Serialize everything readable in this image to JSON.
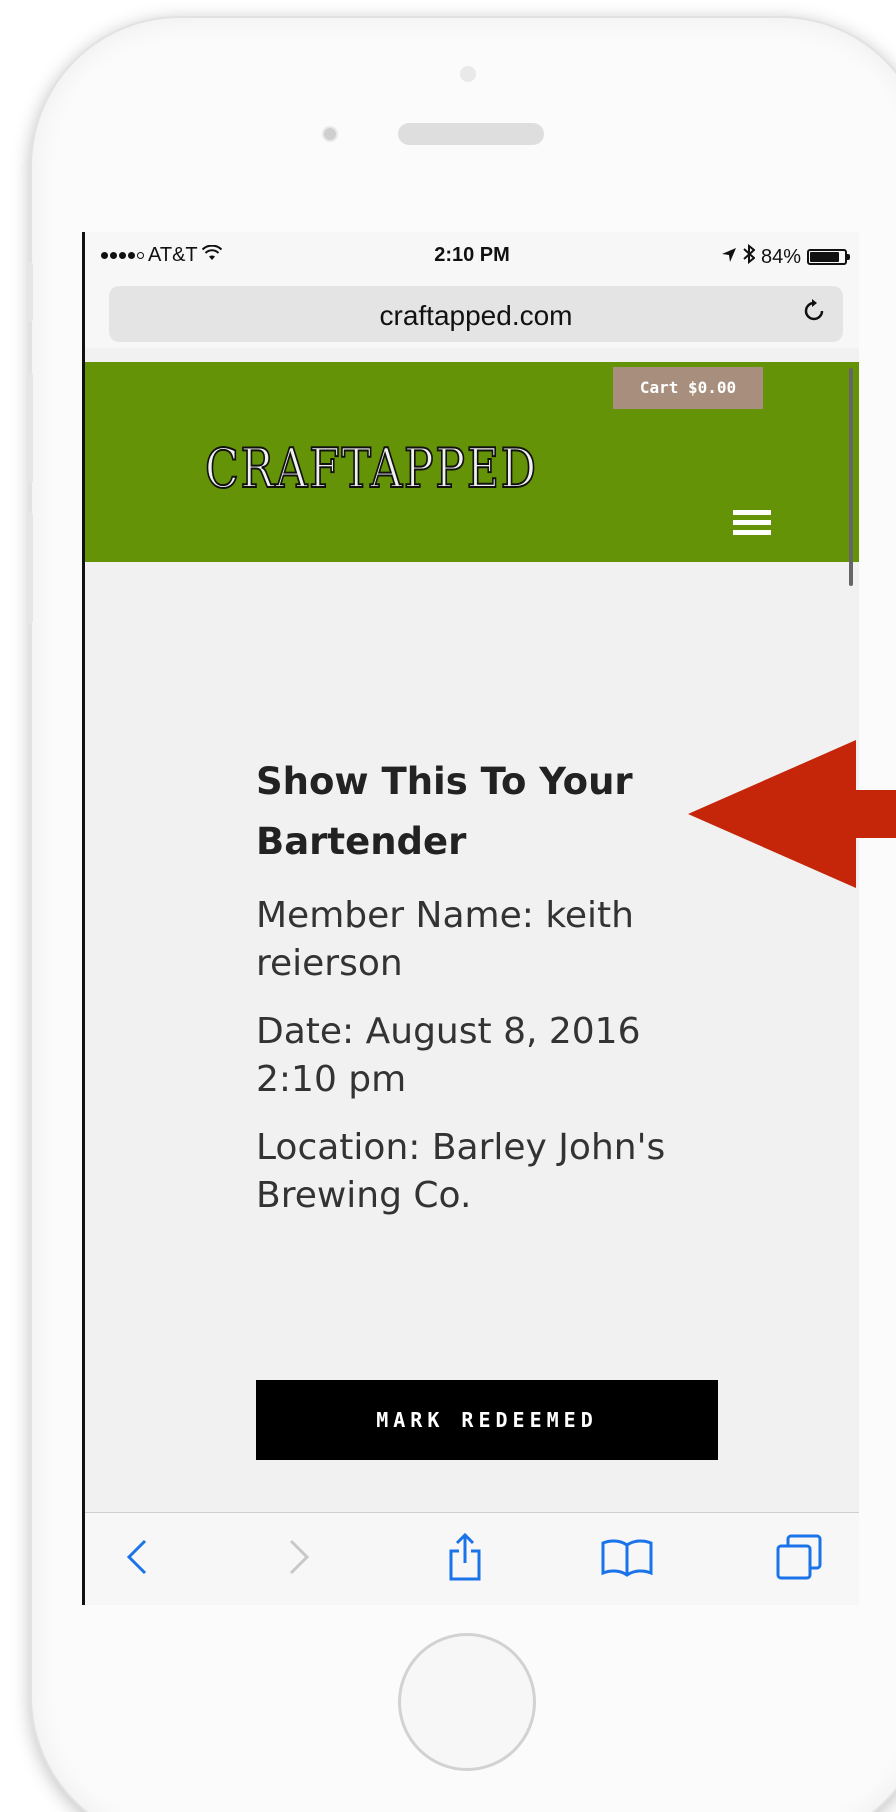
{
  "status_bar": {
    "carrier": "AT&T",
    "time": "2:10 PM",
    "battery": "84%",
    "battery_level": 0.84
  },
  "browser": {
    "url": "craftapped.com"
  },
  "site_header": {
    "cart_label": "Cart $0.00",
    "logo_text": "CRAFTAPPED",
    "header_color": "#649307",
    "cart_color": "#a88e7c"
  },
  "content": {
    "title": "Show This To Your Bartender",
    "member_label": "Member Name:",
    "member_value": "keith reierson",
    "date_label": "Date:",
    "date_value": "August 8, 2016 2:10 pm",
    "location_label": "Location:",
    "location_value": "Barley John's Brewing Co.",
    "redeem_button": "MARK REDEEMED"
  },
  "toolbar": {
    "icons": [
      "back-icon",
      "forward-icon",
      "share-icon",
      "bookmarks-icon",
      "tabs-icon"
    ],
    "accent_color": "#1a73e8"
  },
  "annotation": {
    "arrow_color": "#c52508"
  }
}
